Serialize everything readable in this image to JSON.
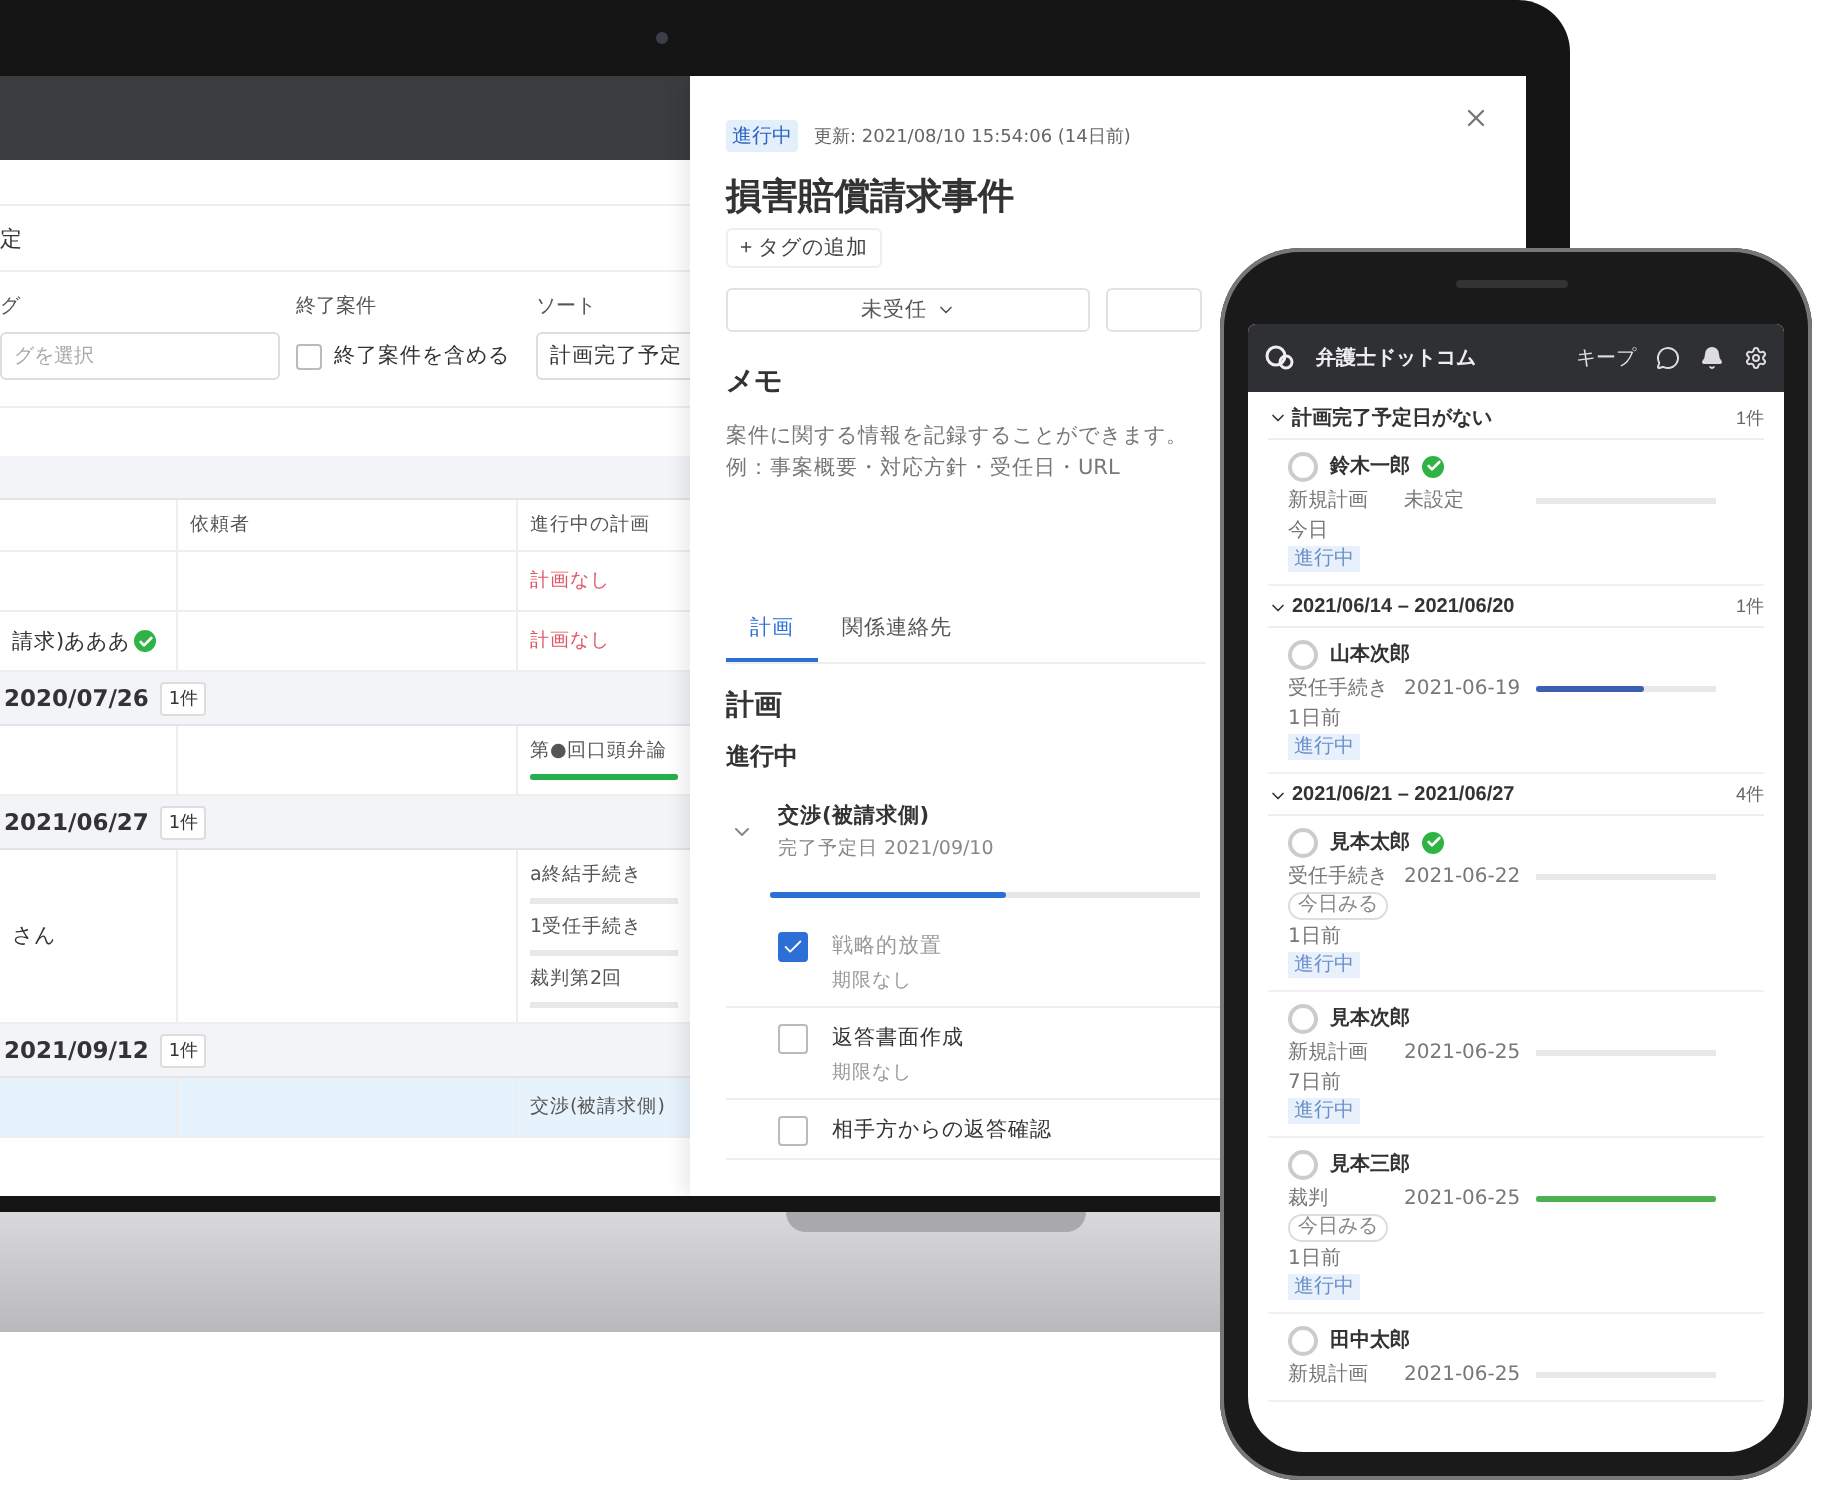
{
  "laptop": {
    "list": {
      "row_fragment": "定",
      "filters": [
        {
          "label": "グ",
          "kind": "field",
          "placeholder": "グを選択"
        },
        {
          "label": "終了案件",
          "kind": "checkbox",
          "text": "終了案件を含める",
          "checked": false
        },
        {
          "label": "ソート",
          "kind": "select",
          "value": "計画完了予定"
        }
      ],
      "table": {
        "columns": [
          "依頼者",
          "進行中の計画"
        ],
        "items": [
          {
            "kind": "row",
            "selected": false,
            "plans": [
              {
                "kind": "none",
                "label": "計画なし"
              }
            ]
          },
          {
            "kind": "row",
            "selected": false,
            "client": "請求)あああ",
            "verified": true,
            "plans": [
              {
                "kind": "none",
                "label": "計画なし"
              }
            ]
          },
          {
            "kind": "group",
            "date": "2020/07/26",
            "count": "1件"
          },
          {
            "kind": "row",
            "selected": false,
            "plans": [
              {
                "kind": "progress",
                "label": "第●回口頭弁論",
                "level": 1,
                "color": "#22b14c"
              }
            ]
          },
          {
            "kind": "group",
            "date": "2021/06/27",
            "count": "1件"
          },
          {
            "kind": "row",
            "selected": false,
            "client": "さん",
            "plans": [
              {
                "kind": "progress",
                "label": "a終結手続き"
              },
              {
                "kind": "progress",
                "label": "1受任手続き"
              },
              {
                "kind": "progress",
                "label": "裁判第2回"
              }
            ]
          },
          {
            "kind": "group",
            "date": "2021/09/12",
            "count": "1件"
          },
          {
            "kind": "row",
            "selected": true,
            "plans": [
              {
                "kind": "text",
                "label": "交渉(被請求側)"
              }
            ]
          }
        ]
      }
    },
    "detail": {
      "status": "進行中",
      "updated": "更新: 2021/08/10 15:54:06 (14日前)",
      "title": "損害賠償請求事件",
      "add_tag": "+ タグの追加",
      "stage": "未受任",
      "memo_title": "メモ",
      "memo_lines": [
        "案件に関する情報を記録することができます。",
        "例：事案概要・対応方針・受任日・URL"
      ],
      "tabs": [
        {
          "label": "計画",
          "selected": true
        },
        {
          "label": "関係連絡先",
          "selected": false
        }
      ],
      "section": "計画",
      "subsection": "進行中",
      "plan": {
        "title": "交渉(被請求側)",
        "due": "完了予定日 2021/09/10",
        "expanded": true,
        "level": 0.55
      },
      "tasks": [
        {
          "title": "戦略的放置",
          "deadline": "期限なし",
          "checked": true
        },
        {
          "title": "返答書面作成",
          "deadline": "期限なし",
          "checked": false
        },
        {
          "title": "相手方からの返答確認",
          "checked": false
        }
      ]
    }
  },
  "phone": {
    "brand": "弁護士ドットコム",
    "keep": "キープ",
    "groups": [
      {
        "title": "計画完了予定日がない",
        "count": "1件",
        "cards": [
          {
            "name": "鈴木一郎",
            "verified": true,
            "plan": "新規計画",
            "date": "未設定",
            "ago": "今日",
            "status": "進行中"
          }
        ]
      },
      {
        "title": "2021/06/14 – 2021/06/20",
        "count": "1件",
        "cards": [
          {
            "name": "山本次郎",
            "plan": "受任手続き",
            "date": "2021-06-19",
            "level": 0.6,
            "color": "#3d5fb0",
            "ago": "1日前",
            "status": "進行中"
          }
        ]
      },
      {
        "title": "2021/06/21 – 2021/06/27",
        "count": "4件",
        "cards": [
          {
            "name": "見本太郎",
            "verified": true,
            "plan": "受任手続き",
            "date": "2021-06-22",
            "tag": "今日みる",
            "ago": "1日前",
            "status": "進行中"
          },
          {
            "name": "見本次郎",
            "plan": "新規計画",
            "date": "2021-06-25",
            "ago": "7日前",
            "status": "進行中"
          },
          {
            "name": "見本三郎",
            "plan": "裁判",
            "date": "2021-06-25",
            "level": 1,
            "color": "#4caf50",
            "tag": "今日みる",
            "ago": "1日前",
            "status": "進行中"
          },
          {
            "name": "田中太郎",
            "plan": "新規計画",
            "date": "2021-06-25"
          }
        ]
      }
    ]
  }
}
